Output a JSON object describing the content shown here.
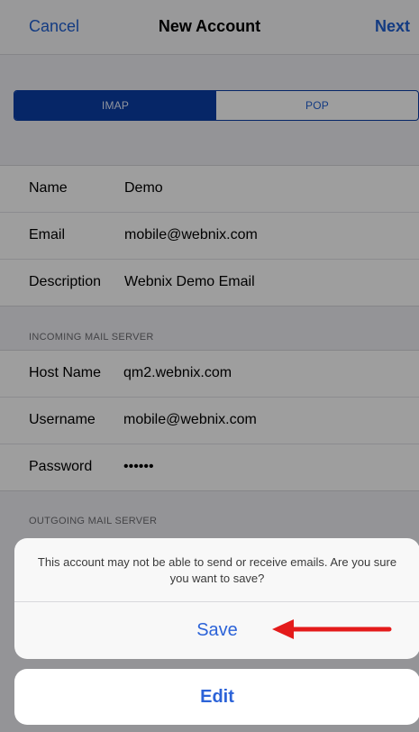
{
  "navbar": {
    "cancel_label": "Cancel",
    "title": "New Account",
    "next_label": "Next"
  },
  "segmented_control": {
    "options": [
      "IMAP",
      "POP"
    ],
    "selected": "IMAP"
  },
  "account": {
    "rows": [
      {
        "label": "Name",
        "value": "Demo"
      },
      {
        "label": "Email",
        "value": "mobile@webnix.com"
      },
      {
        "label": "Description",
        "value": "Webnix Demo Email"
      }
    ]
  },
  "incoming": {
    "header": "INCOMING MAIL SERVER",
    "rows": [
      {
        "label": "Host Name",
        "value": "qm2.webnix.com"
      },
      {
        "label": "Username",
        "value": "mobile@webnix.com"
      },
      {
        "label": "Password",
        "value": "••••••"
      }
    ]
  },
  "outgoing": {
    "header": "OUTGOING MAIL SERVER"
  },
  "action_sheet": {
    "message": "This account may not be able to send or receive emails. Are you sure you want to save?",
    "save_label": "Save",
    "edit_label": "Edit"
  },
  "colors": {
    "accent": "#2c63d8",
    "segment_active": "#0b3ea7",
    "annotation_arrow": "#e41b1b"
  }
}
